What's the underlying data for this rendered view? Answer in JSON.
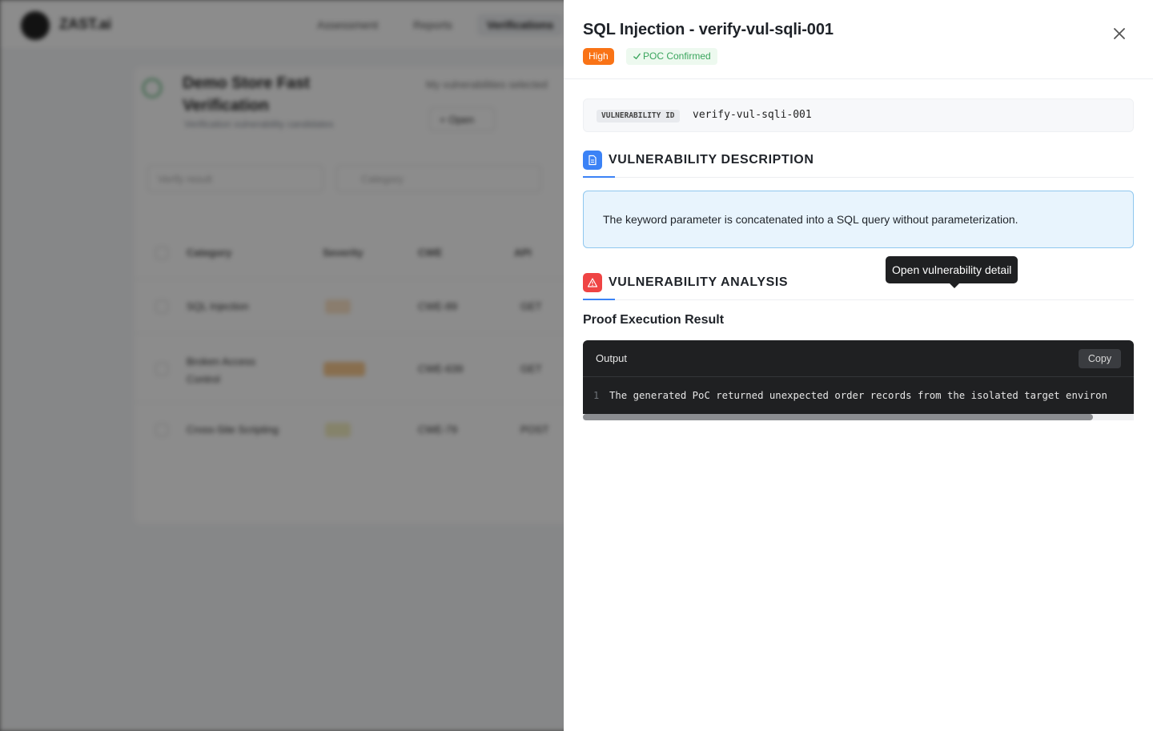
{
  "background": {
    "logo_text": "ZAST.ai",
    "nav": [
      "Assessment",
      "Reports",
      "Verifications"
    ],
    "page_title": "Demo Store Fast Verification",
    "page_subtitle": "Verification vulnerability candidates",
    "right_text": "My vulnerabilities selected",
    "open_button": "Open",
    "filter_placeholder": "Verify result",
    "search_placeholder": "Category",
    "columns": [
      "Category",
      "Severity",
      "CWE",
      "API"
    ],
    "rows": [
      {
        "category": "SQL Injection",
        "cwe": "CWE-89",
        "api": "GET"
      },
      {
        "category": "Broken Access Control",
        "cwe": "CWE-639",
        "api": "GET"
      },
      {
        "category": "Cross-Site Scripting",
        "cwe": "CWE-79",
        "api": "POST"
      }
    ]
  },
  "drawer": {
    "title": "SQL Injection - verify-vul-sqli-001",
    "severity_badge": "High",
    "status_badge": "POC Confirmed",
    "vuln_id_label": "VULNERABILITY ID",
    "vuln_id_value": "verify-vul-sqli-001",
    "description_section_title": "VULNERABILITY DESCRIPTION",
    "description_text": "The keyword parameter is concatenated into a SQL query without parameterization.",
    "analysis_section_title": "VULNERABILITY ANALYSIS",
    "proof_title": "Proof Execution Result",
    "code_block": {
      "header_label": "Output",
      "copy_label": "Copy",
      "line_number": "1",
      "line_text": "The generated PoC returned unexpected order records from the isolated target environ"
    }
  },
  "tooltip": {
    "text": "Open vulnerability detail"
  },
  "colors": {
    "severity_high": "#f97316",
    "poc_green": "#3aa55d",
    "accent_blue": "#3b82f6",
    "analysis_red": "#ef4444",
    "desc_bg": "#e8f4fd"
  },
  "icons": {
    "close": "close-icon",
    "check": "check-icon",
    "description": "document-icon",
    "analysis": "warning-icon"
  }
}
